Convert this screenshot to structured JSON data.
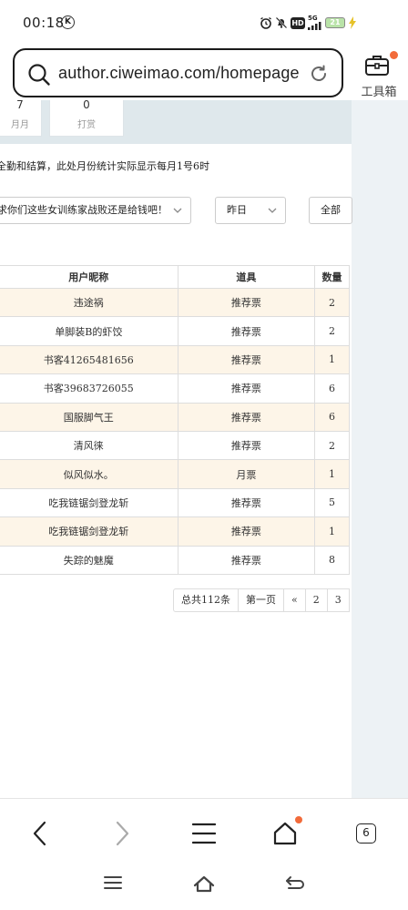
{
  "status_bar": {
    "time": "00:18",
    "k_badge": "K",
    "network": "5G",
    "hd": "HD",
    "battery": "21"
  },
  "address_bar": {
    "url": "author.ciweimao.com/homepage"
  },
  "toolbox": {
    "label": "工具箱"
  },
  "stats": [
    {
      "value": "7",
      "label": "月月"
    },
    {
      "value": "0",
      "label": "打赏"
    }
  ],
  "notice": "全勤和结算，此处月份统计实际显示每月1号6时",
  "filters": {
    "book_select": "求你们这些女训练家战败还是给钱吧！",
    "date_select": "昨日",
    "type_select": "全部"
  },
  "table": {
    "headers": [
      "用户昵称",
      "道具",
      "数量"
    ],
    "rows": [
      {
        "name": "违途祸",
        "item": "推荐票",
        "qty": "2"
      },
      {
        "name": "单脚装B的虾饺",
        "item": "推荐票",
        "qty": "2"
      },
      {
        "name": "书客41265481656",
        "item": "推荐票",
        "qty": "1"
      },
      {
        "name": "书客39683726055",
        "item": "推荐票",
        "qty": "6"
      },
      {
        "name": "国服脚气王",
        "item": "推荐票",
        "qty": "6"
      },
      {
        "name": "清风徕",
        "item": "推荐票",
        "qty": "2"
      },
      {
        "name": "似风似水。",
        "item": "月票",
        "qty": "1"
      },
      {
        "name": "吃我链锯剑登龙斩",
        "item": "推荐票",
        "qty": "5"
      },
      {
        "name": "吃我链锯剑登龙斩",
        "item": "推荐票",
        "qty": "1"
      },
      {
        "name": "失踪的魅魔",
        "item": "推荐票",
        "qty": "8"
      }
    ]
  },
  "pager": {
    "total": "总共112条",
    "first": "第一页",
    "prev": "«",
    "pages": [
      "2",
      "3"
    ]
  },
  "browser_nav": {
    "tabs_count": "6"
  },
  "colors": {
    "accent_dot": "#f26b3a",
    "row_highlight": "#fdf5e8",
    "side_panel": "#edf2f5"
  }
}
